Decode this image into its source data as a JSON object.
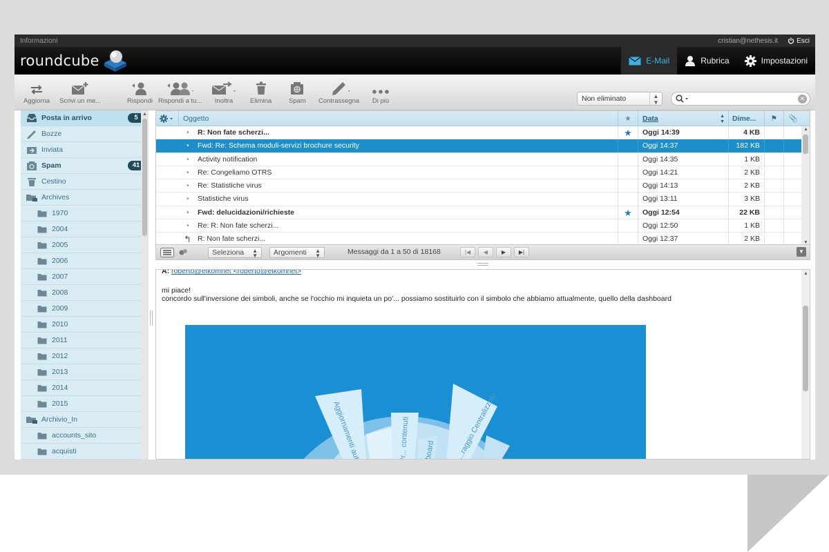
{
  "topbar": {
    "info_link": "Informazioni",
    "user_email": "cristian@nethesis.it",
    "logout_label": "Esci"
  },
  "header": {
    "logo_text": "roundcube",
    "nav": [
      {
        "label": "E-Mail",
        "icon": "envelope-icon",
        "active": true
      },
      {
        "label": "Rubrica",
        "icon": "person-icon",
        "active": false
      },
      {
        "label": "Impostazioni",
        "icon": "gear-icon",
        "active": false
      }
    ]
  },
  "toolbar": {
    "buttons": [
      {
        "label": "Aggiorna",
        "icon": "refresh-icon"
      },
      {
        "label": "Scrivi un me...",
        "icon": "compose-icon"
      },
      {
        "label": "Rispondi",
        "icon": "reply-icon"
      },
      {
        "label": "Rispondi a tu...",
        "icon": "reply-all-icon"
      },
      {
        "label": "Inoltra",
        "icon": "forward-icon"
      },
      {
        "label": "Elimina",
        "icon": "trash-icon"
      },
      {
        "label": "Spam",
        "icon": "spam-icon"
      },
      {
        "label": "Contrassegna",
        "icon": "mark-icon"
      },
      {
        "label": "Di più",
        "icon": "more-icon"
      }
    ],
    "filter_value": "Non eliminato",
    "search_placeholder": ""
  },
  "sidebar": {
    "folders": [
      {
        "name": "Posta in arrivo",
        "icon": "inbox-icon",
        "count": "5",
        "selected": true,
        "sub": false,
        "bold": true
      },
      {
        "name": "Bozze",
        "icon": "pencil-icon",
        "count": "",
        "selected": false,
        "sub": false,
        "bold": false
      },
      {
        "name": "Inviata",
        "icon": "sent-icon",
        "count": "",
        "selected": false,
        "sub": false,
        "bold": false
      },
      {
        "name": "Spam",
        "icon": "spam-icon",
        "count": "41",
        "selected": false,
        "sub": false,
        "bold": true
      },
      {
        "name": "Cestino",
        "icon": "trash-icon",
        "count": "",
        "selected": false,
        "sub": false,
        "bold": false
      },
      {
        "name": "Archives",
        "icon": "archive-icon",
        "count": "",
        "selected": false,
        "sub": false,
        "bold": false
      },
      {
        "name": "1970",
        "icon": "folder-icon",
        "count": "",
        "selected": false,
        "sub": true,
        "bold": false
      },
      {
        "name": "2004",
        "icon": "folder-icon",
        "count": "",
        "selected": false,
        "sub": true,
        "bold": false
      },
      {
        "name": "2005",
        "icon": "folder-icon",
        "count": "",
        "selected": false,
        "sub": true,
        "bold": false
      },
      {
        "name": "2006",
        "icon": "folder-icon",
        "count": "",
        "selected": false,
        "sub": true,
        "bold": false
      },
      {
        "name": "2007",
        "icon": "folder-icon",
        "count": "",
        "selected": false,
        "sub": true,
        "bold": false
      },
      {
        "name": "2008",
        "icon": "folder-icon",
        "count": "",
        "selected": false,
        "sub": true,
        "bold": false
      },
      {
        "name": "2009",
        "icon": "folder-icon",
        "count": "",
        "selected": false,
        "sub": true,
        "bold": false
      },
      {
        "name": "2010",
        "icon": "folder-icon",
        "count": "",
        "selected": false,
        "sub": true,
        "bold": false
      },
      {
        "name": "2011",
        "icon": "folder-icon",
        "count": "",
        "selected": false,
        "sub": true,
        "bold": false
      },
      {
        "name": "2012",
        "icon": "folder-icon",
        "count": "",
        "selected": false,
        "sub": true,
        "bold": false
      },
      {
        "name": "2013",
        "icon": "folder-icon",
        "count": "",
        "selected": false,
        "sub": true,
        "bold": false
      },
      {
        "name": "2014",
        "icon": "folder-icon",
        "count": "",
        "selected": false,
        "sub": true,
        "bold": false
      },
      {
        "name": "2015",
        "icon": "folder-icon",
        "count": "",
        "selected": false,
        "sub": true,
        "bold": false
      },
      {
        "name": "Archivio_In",
        "icon": "archive-icon",
        "count": "",
        "selected": false,
        "sub": false,
        "bold": false
      },
      {
        "name": "accounts_sito",
        "icon": "folder-icon",
        "count": "",
        "selected": false,
        "sub": true,
        "bold": false
      },
      {
        "name": "acquisti",
        "icon": "folder-icon",
        "count": "",
        "selected": false,
        "sub": true,
        "bold": false
      }
    ]
  },
  "messagelist": {
    "columns": {
      "subject": "Oggetto",
      "date": "Data",
      "size": "Dime..."
    },
    "messages": [
      {
        "subject": "R: Non fate scherzi...",
        "date": "Oggi 14:39",
        "size": "4 KB",
        "unread": true,
        "flagged": true,
        "selected": false,
        "replied": false
      },
      {
        "subject": "Fwd: Re: Schema moduli-servizi brochure security",
        "date": "Oggi 14:37",
        "size": "182 KB",
        "unread": false,
        "flagged": false,
        "selected": true,
        "replied": false
      },
      {
        "subject": "Activity notification",
        "date": "Oggi 14:35",
        "size": "1 KB",
        "unread": false,
        "flagged": false,
        "selected": false,
        "replied": false
      },
      {
        "subject": "Re: Congeliamo OTRS",
        "date": "Oggi 14:21",
        "size": "2 KB",
        "unread": false,
        "flagged": false,
        "selected": false,
        "replied": false
      },
      {
        "subject": "Re: Statistiche virus",
        "date": "Oggi 14:13",
        "size": "2 KB",
        "unread": false,
        "flagged": false,
        "selected": false,
        "replied": false
      },
      {
        "subject": "Statistiche virus",
        "date": "Oggi 13:11",
        "size": "3 KB",
        "unread": false,
        "flagged": false,
        "selected": false,
        "replied": false
      },
      {
        "subject": "Fwd: delucidazioni/richieste",
        "date": "Oggi 12:54",
        "size": "22 KB",
        "unread": true,
        "flagged": true,
        "selected": false,
        "replied": false
      },
      {
        "subject": "Re: R: Non fate scherzi...",
        "date": "Oggi 12:50",
        "size": "1 KB",
        "unread": false,
        "flagged": false,
        "selected": false,
        "replied": false
      },
      {
        "subject": "R: Non fate scherzi...",
        "date": "Oggi 12:37",
        "size": "2 KB",
        "unread": false,
        "flagged": false,
        "selected": false,
        "replied": true
      }
    ],
    "footer": {
      "select_label": "Seleziona",
      "threads_label": "Argomenti",
      "count_text": "Messaggi da 1 a 50 di 18168"
    }
  },
  "preview": {
    "to_label": "A:",
    "to_value": "roberto@elkomnet <roberto@elkomnet>",
    "line1": "mi piace!",
    "line2": "concordo sull'inversione dei simboli, anche se l'occhio mi inquieta un po'... possiamo sostituirlo con il simbolo che abbiamo attualmente, quello della dashboard",
    "image_labels": [
      "Aggiornamenti auto",
      "Pr... contenuti",
      "...board",
      "...raggio Centralizzato"
    ]
  },
  "colors": {
    "accent": "#1c8ec9",
    "sidebar_bg": "#d9ecf4",
    "badge": "#1f4a5c",
    "image_bg": "#1a8fd4"
  }
}
